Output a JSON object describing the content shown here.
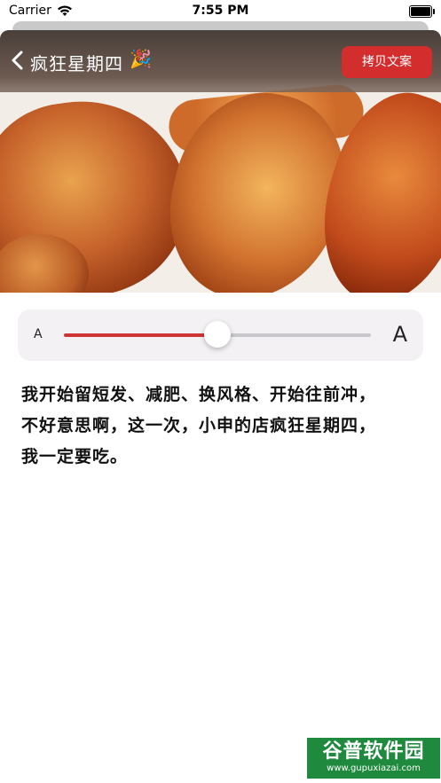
{
  "status_bar": {
    "carrier": "Carrier",
    "time": "7:55 PM"
  },
  "header": {
    "title": "疯狂星期四",
    "emoji": "🎉",
    "copy_button": "拷贝文案"
  },
  "font_slider": {
    "min_label": "A",
    "max_label": "A",
    "value": 0.5,
    "accent_color": "#cf3535"
  },
  "content": {
    "lines": [
      "我开始留短发、减肥、换风格、开始往前冲，",
      "不好意思啊，这一次，小申的店疯狂星期四，",
      "我一定要吃。"
    ]
  },
  "watermark": {
    "brand": "谷普软件园",
    "url": "www.gupuxiazai.com"
  }
}
